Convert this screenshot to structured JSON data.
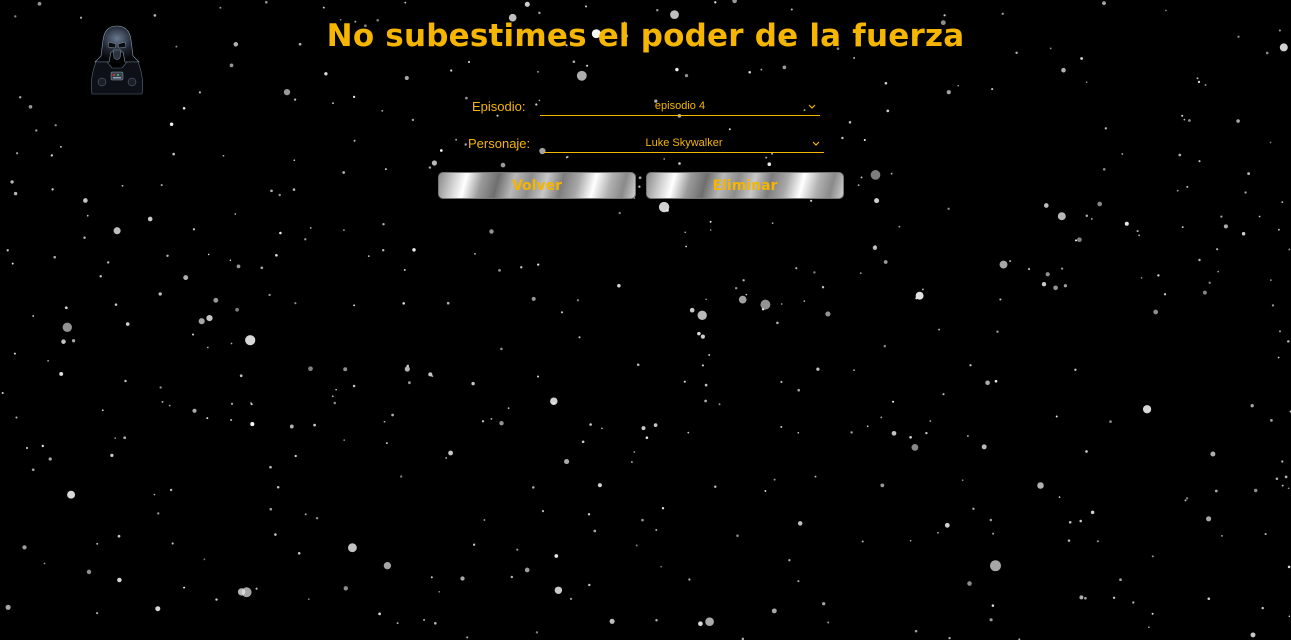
{
  "header": {
    "title": "No subestimes el poder de la fuerza"
  },
  "form": {
    "episode_label": "Episodio:",
    "episode_value": "episodio 4",
    "character_label": "Personaje:",
    "character_value": "Luke Skywalker"
  },
  "actions": {
    "back_label": "Volver",
    "delete_label": "Eliminar"
  },
  "colors": {
    "accent": "#f5b500",
    "background": "#000000"
  }
}
